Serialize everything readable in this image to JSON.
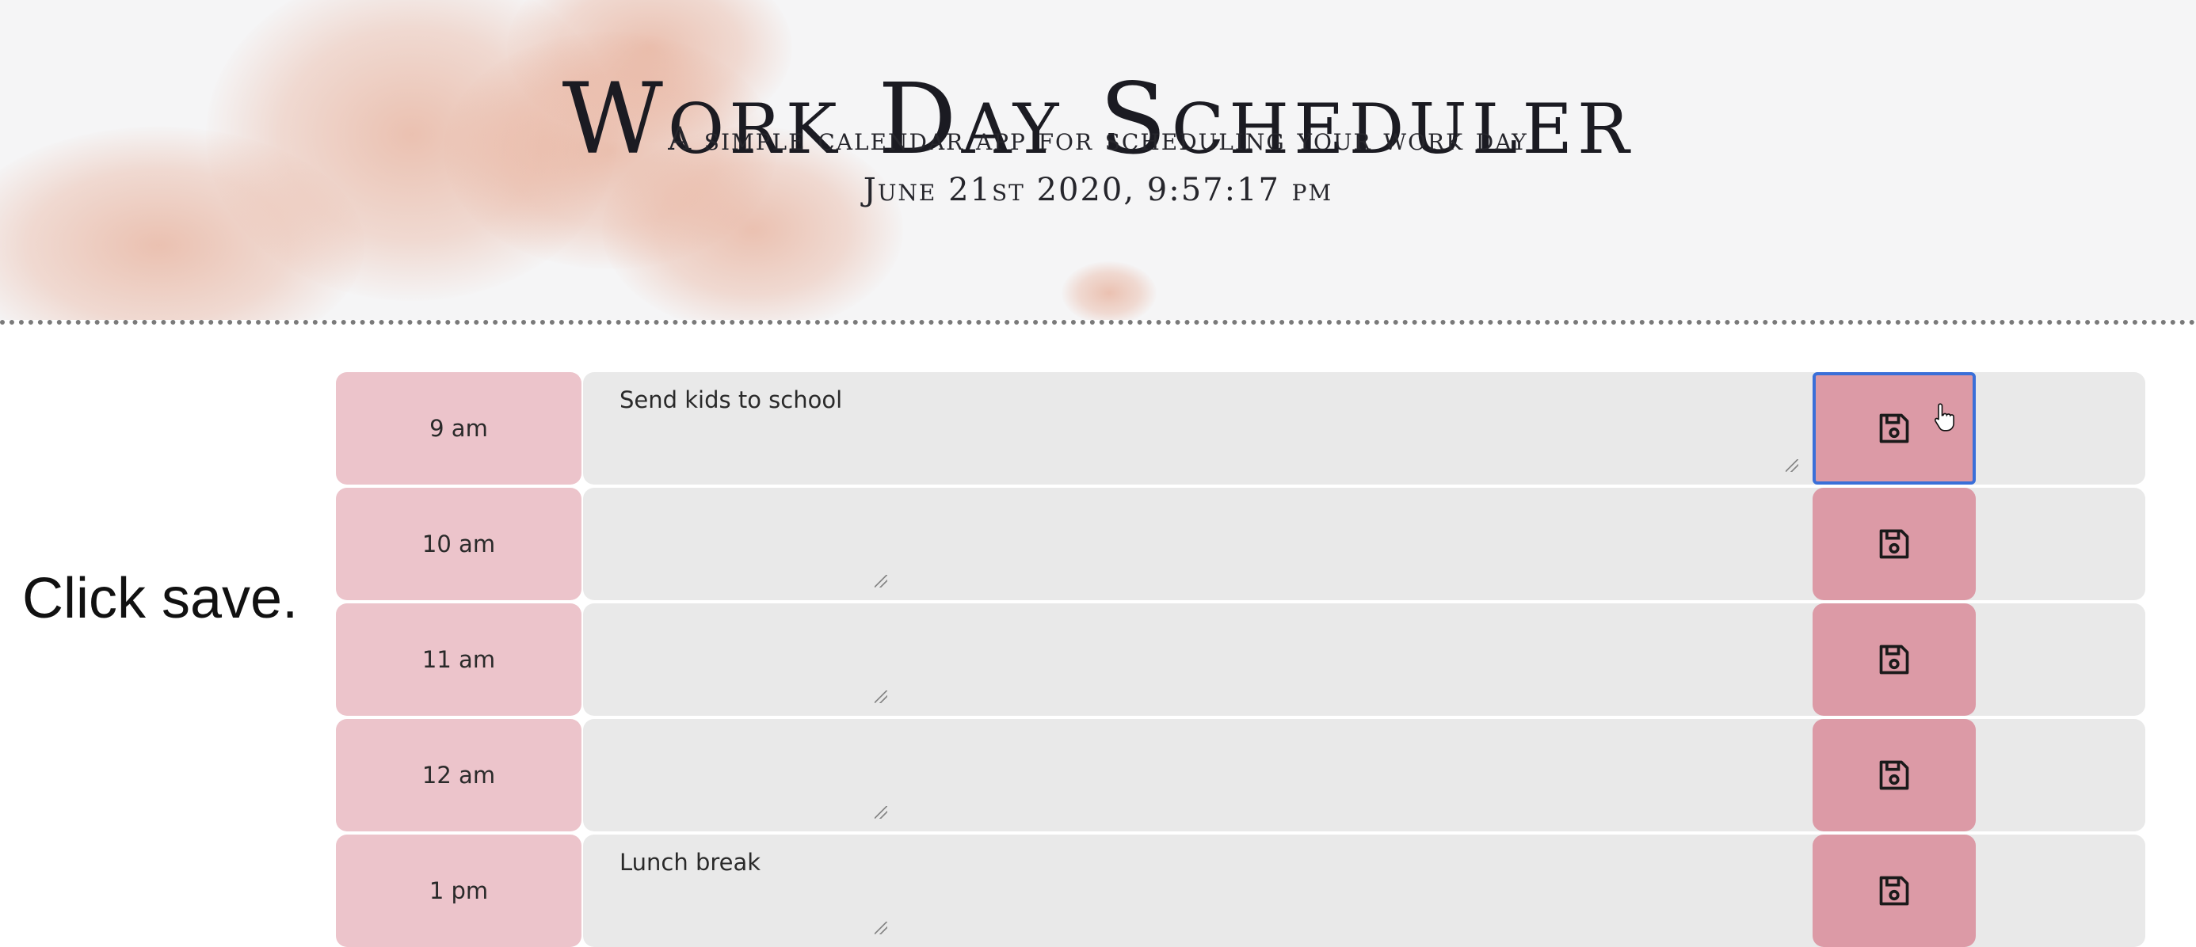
{
  "header": {
    "title": "Work Day Scheduler",
    "subtitle": "A simple calendar app for scheduling your work day",
    "datetime": "June 21st 2020, 9:57:17 pm"
  },
  "caption": "Click save.",
  "colors": {
    "hour_bg": "#ecc4cb",
    "description_bg": "#e9e9e9",
    "save_bg": "#dc9aa6",
    "focus_ring": "#3a6fd8"
  },
  "rows": [
    {
      "hour": "9 am",
      "text": "Send kids to school"
    },
    {
      "hour": "10 am",
      "text": ""
    },
    {
      "hour": "11 am",
      "text": ""
    },
    {
      "hour": "12 am",
      "text": ""
    },
    {
      "hour": "1 pm",
      "text": "Lunch break"
    }
  ],
  "icons": {
    "save": "floppy-disk-icon",
    "cursor": "hand-pointer-cursor"
  }
}
